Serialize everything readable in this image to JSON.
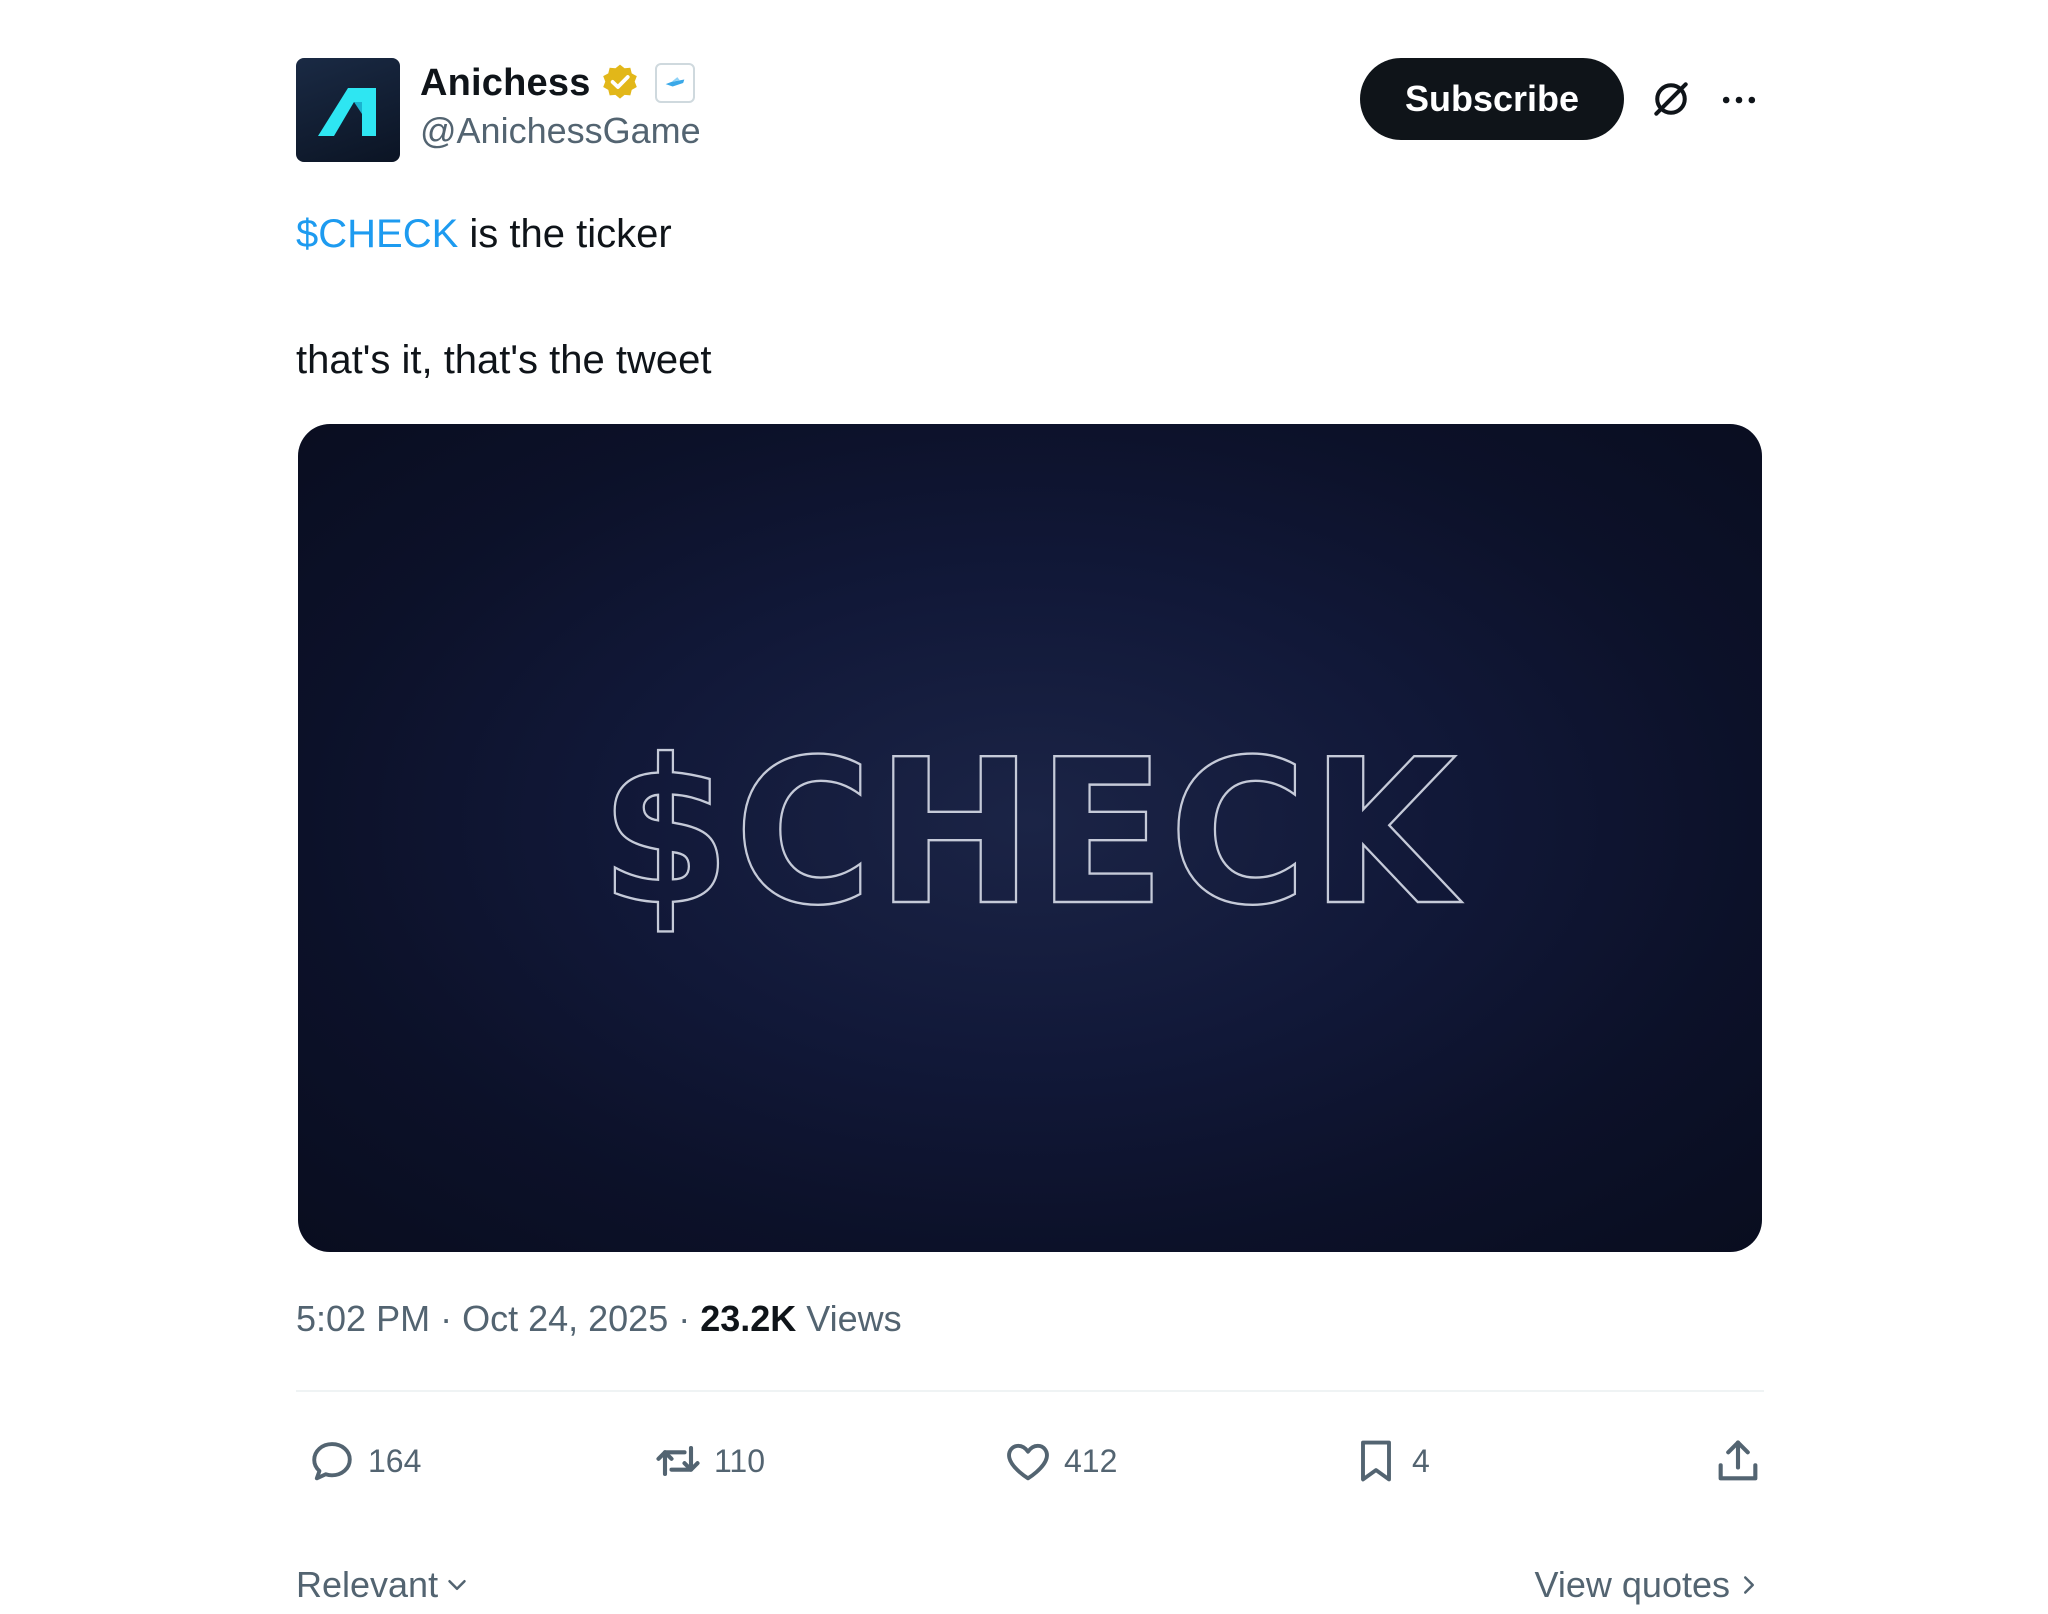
{
  "author": {
    "display_name": "Anichess",
    "handle": "@AnichessGame",
    "verified_badge_color": "#e2b719",
    "avatar_icon": "anichess-logo-icon",
    "affiliate_icon": "affiliate-badge-icon"
  },
  "header": {
    "subscribe_label": "Subscribe",
    "grok_icon": "grok-icon",
    "more_icon": "more-icon"
  },
  "post": {
    "cashtag": "$CHECK",
    "line1_rest": " is the ticker",
    "line2": "that's it, that's the tweet",
    "cashtag_color": "#1d9bf0"
  },
  "media": {
    "image_text": "$CHECK",
    "background_color": "#0c1129",
    "outline_color": "#c5cad8"
  },
  "meta": {
    "time": "5:02 PM",
    "separator": " · ",
    "date": "Oct 24, 2025",
    "views_count": "23.2K",
    "views_label": " Views"
  },
  "actions": {
    "replies": "164",
    "reposts": "110",
    "likes": "412",
    "bookmarks": "4"
  },
  "footer": {
    "sort_label": "Relevant",
    "view_quotes_label": "View quotes"
  },
  "colors": {
    "text_primary": "#0f1419",
    "text_secondary": "#536471",
    "divider": "#eff3f4"
  }
}
